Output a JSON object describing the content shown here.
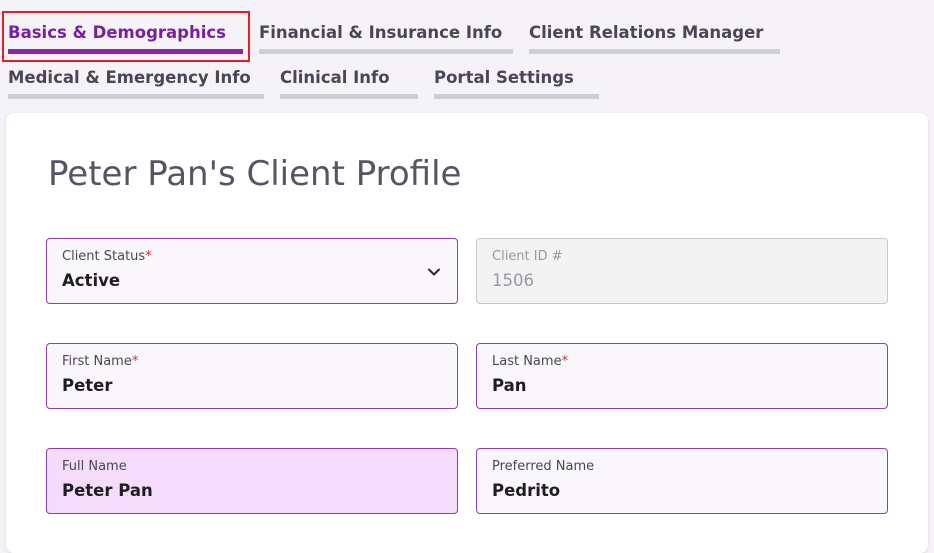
{
  "tabs": [
    {
      "label": "Basics & Demographics"
    },
    {
      "label": "Financial & Insurance Info"
    },
    {
      "label": "Client Relations Manager"
    },
    {
      "label": "Medical & Emergency Info"
    },
    {
      "label": "Clinical Info"
    },
    {
      "label": "Portal Settings"
    }
  ],
  "active_tab": "Basics & Demographics",
  "profile": {
    "title": "Peter Pan's Client Profile",
    "fields": {
      "client_status": {
        "label": "Client Status",
        "required": "*",
        "value": "Active"
      },
      "client_id": {
        "label": "Client ID #",
        "value": "1506"
      },
      "first_name": {
        "label": "First Name",
        "required": "*",
        "value": "Peter"
      },
      "last_name": {
        "label": "Last Name",
        "required": "*",
        "value": "Pan"
      },
      "full_name": {
        "label": "Full Name",
        "value": "Peter Pan"
      },
      "preferred_name": {
        "label": "Preferred Name",
        "value": "Pedrito"
      }
    }
  },
  "colors": {
    "accent": "#8e24aa",
    "highlight": "#e0202a",
    "required": "#d32f2f"
  },
  "icons": {
    "status_dropdown": "chevron-down-icon"
  }
}
